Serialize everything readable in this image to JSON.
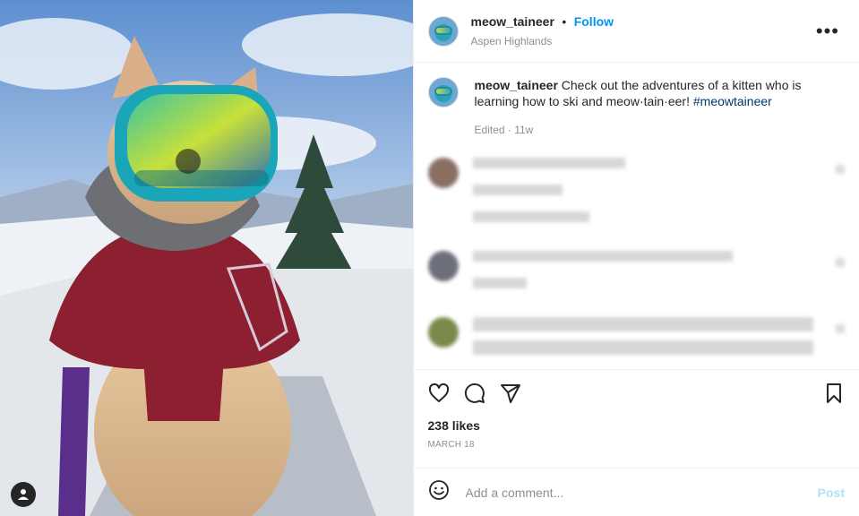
{
  "post": {
    "username": "meow_taineer",
    "dot": "•",
    "follow_label": "Follow",
    "location": "Aspen Highlands",
    "more_label": "•••"
  },
  "caption": {
    "username": "meow_taineer",
    "text": "Check out the adventures of a kitten who is learning how to ski and meow·tain·eer!",
    "hashtag": "#meowtaineer",
    "meta": "Edited · 11w"
  },
  "engagement": {
    "likes": "238 likes",
    "date": "MARCH 18"
  },
  "comment_box": {
    "placeholder": "Add a comment...",
    "post_label": "Post"
  },
  "icons": {
    "like": "heart-icon",
    "comment": "comment-icon",
    "share": "share-icon",
    "save": "bookmark-icon",
    "emoji": "emoji-icon",
    "tag": "user-tag-icon"
  },
  "colors": {
    "accent": "#0095f6",
    "post_disabled": "#b2dffc",
    "hashtag": "#00376b"
  }
}
